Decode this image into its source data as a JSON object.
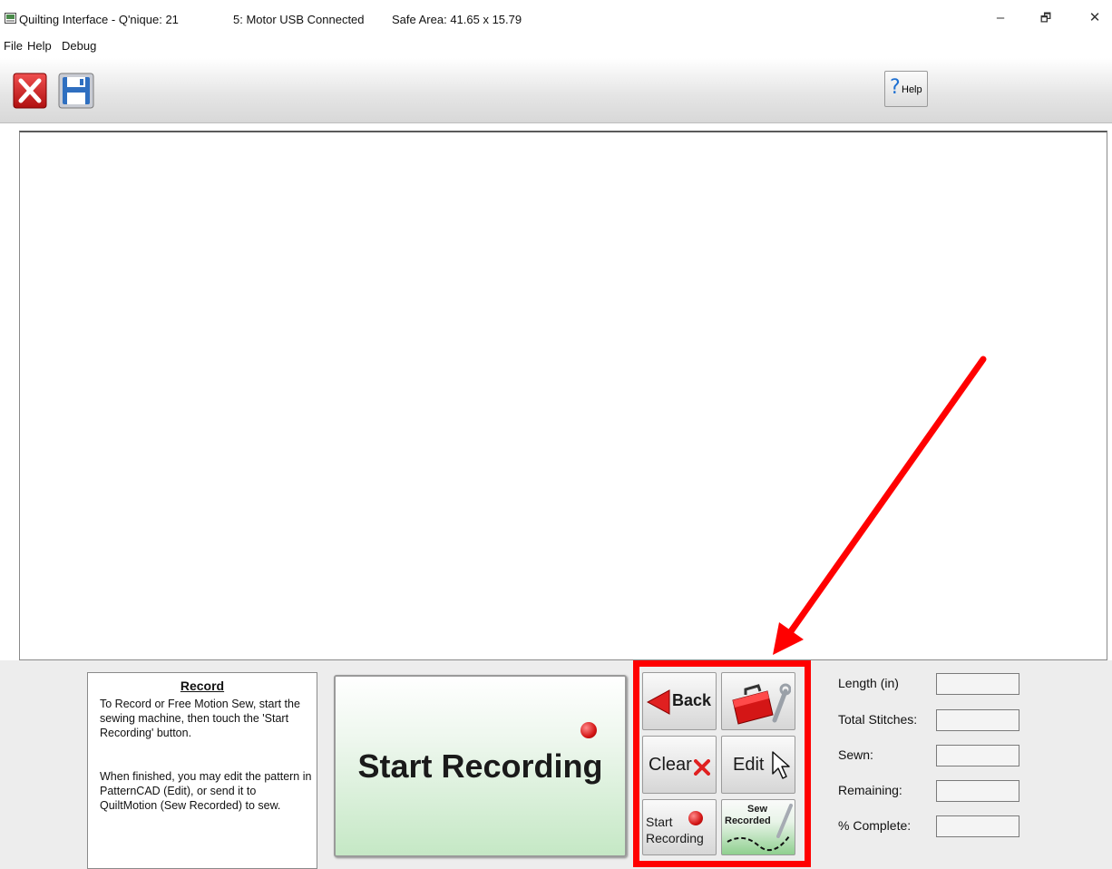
{
  "window": {
    "title": "Quilting Interface  - Q'nique: 21",
    "status": "5: Motor USB Connected",
    "safe_area": "Safe Area:  41.65 x 15.79",
    "minimize": "–",
    "restore": "🗗",
    "close": "✕"
  },
  "menu": {
    "items": [
      "File",
      "Help",
      "Debug"
    ]
  },
  "toolbar": {
    "help_label": "Help",
    "help_q": "?"
  },
  "info": {
    "title": "Record",
    "p1": "To Record or Free Motion Sew, start the sewing machine, then touch the 'Start Recording' button.",
    "p2": "When finished, you may edit the pattern in PatternCAD (Edit), or send it to QuiltMotion (Sew Recorded) to sew."
  },
  "main_button": {
    "label": "Start Recording"
  },
  "grid": {
    "back": "Back",
    "clear": "Clear",
    "edit": "Edit",
    "start_line1": "Start",
    "start_line2": "Recording",
    "sew_line1": "Sew",
    "sew_line2": "Recorded"
  },
  "stats": {
    "length": "Length (in)",
    "total": "Total Stitches:",
    "sewn": "Sewn:",
    "remaining": "Remaining:",
    "complete": "% Complete:"
  },
  "colors": {
    "highlight": "#ff0000",
    "record_dot": "#d41616",
    "accent_blue": "#1d6fd1"
  }
}
